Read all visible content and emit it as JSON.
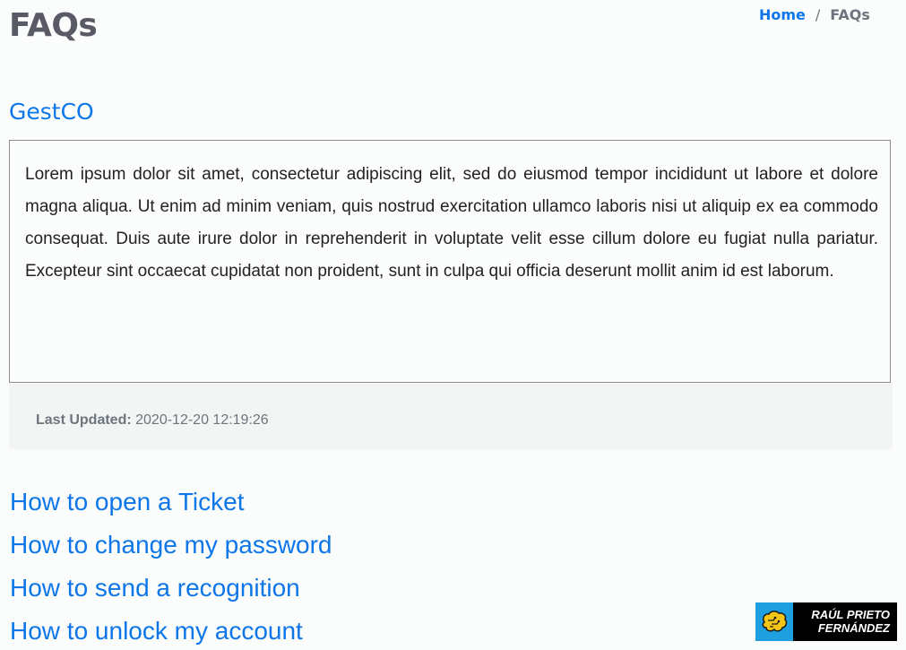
{
  "header": {
    "title": "FAQs",
    "breadcrumb": {
      "home_label": "Home",
      "separator": "/",
      "current_label": "FAQs"
    }
  },
  "article": {
    "title": "GestCO",
    "body": "Lorem ipsum dolor sit amet, consectetur adipiscing elit, sed do eiusmod tempor incididunt ut labore et dolore magna aliqua. Ut enim ad minim veniam, quis nostrud exercitation ullamco laboris nisi ut aliquip ex ea commodo consequat. Duis aute irure dolor in reprehenderit in voluptate velit esse cillum dolore eu fugiat nulla pariatur. Excepteur sint occaecat cupidatat non proident, sunt in culpa qui officia deserunt mollit anim id est laborum.",
    "last_updated_label": "Last Updated:",
    "last_updated_value": "2020-12-20 12:19:26"
  },
  "faq_links": [
    {
      "label": "How to open a Ticket"
    },
    {
      "label": "How to change my password"
    },
    {
      "label": "How to send a recognition"
    },
    {
      "label": "How to unlock my account"
    }
  ],
  "brand": {
    "icon": "brain-circuit-icon",
    "line1": "RAÚL PRIETO",
    "line2": "FERNÁNDEZ"
  },
  "colors": {
    "link": "#0d76e8",
    "title": "#5a5a66",
    "muted": "#6c757d",
    "brand_blue": "#1ea0e0",
    "brand_yellow": "#f5c518"
  }
}
